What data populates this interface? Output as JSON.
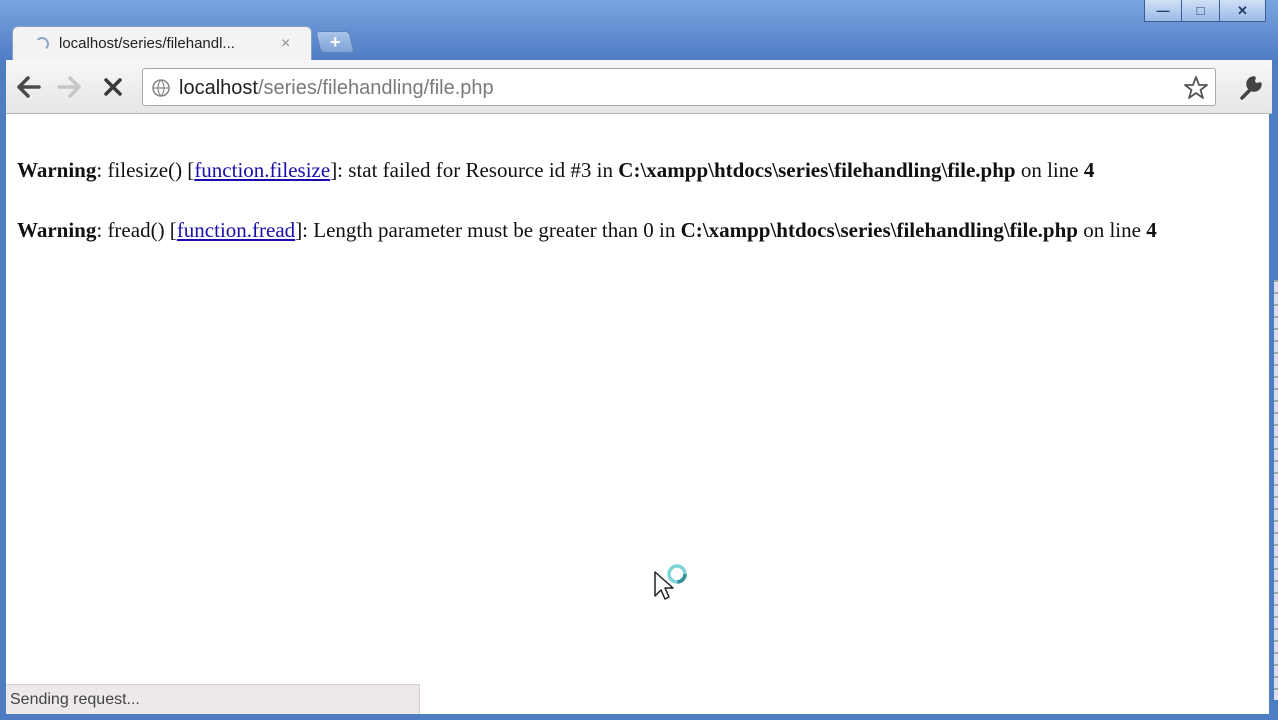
{
  "window": {
    "minimize_glyph": "—",
    "maximize_glyph": "□",
    "close_glyph": "✕"
  },
  "tab": {
    "title": "localhost/series/filehandl...",
    "close_glyph": "×",
    "new_tab_glyph": "+"
  },
  "toolbar": {
    "back_icon": "back-arrow-icon",
    "forward_icon": "forward-arrow-icon",
    "stop_icon": "stop-icon",
    "stop_glyph": "✕",
    "url_host": "localhost",
    "url_path": "/series/filehandling/file.php",
    "bookmark_icon": "star-icon",
    "menu_icon": "wrench-icon"
  },
  "warnings": [
    {
      "label": "Warning",
      "func": ": filesize() [",
      "link": "function.filesize",
      "msg": "]: stat failed for Resource id #3 in ",
      "path": "C:\\xampp\\htdocs\\series\\filehandling\\file.php",
      "online": " on line ",
      "line": "4"
    },
    {
      "label": "Warning",
      "func": ": fread() [",
      "link": "function.fread",
      "msg": "]: Length parameter must be greater than 0 in ",
      "path": "C:\\xampp\\htdocs\\series\\filehandling\\file.php",
      "online": " on line ",
      "line": "4"
    }
  ],
  "status": {
    "text": "Sending request..."
  },
  "colors": {
    "link": "#1a0dab",
    "frame": "#5a86c8"
  }
}
